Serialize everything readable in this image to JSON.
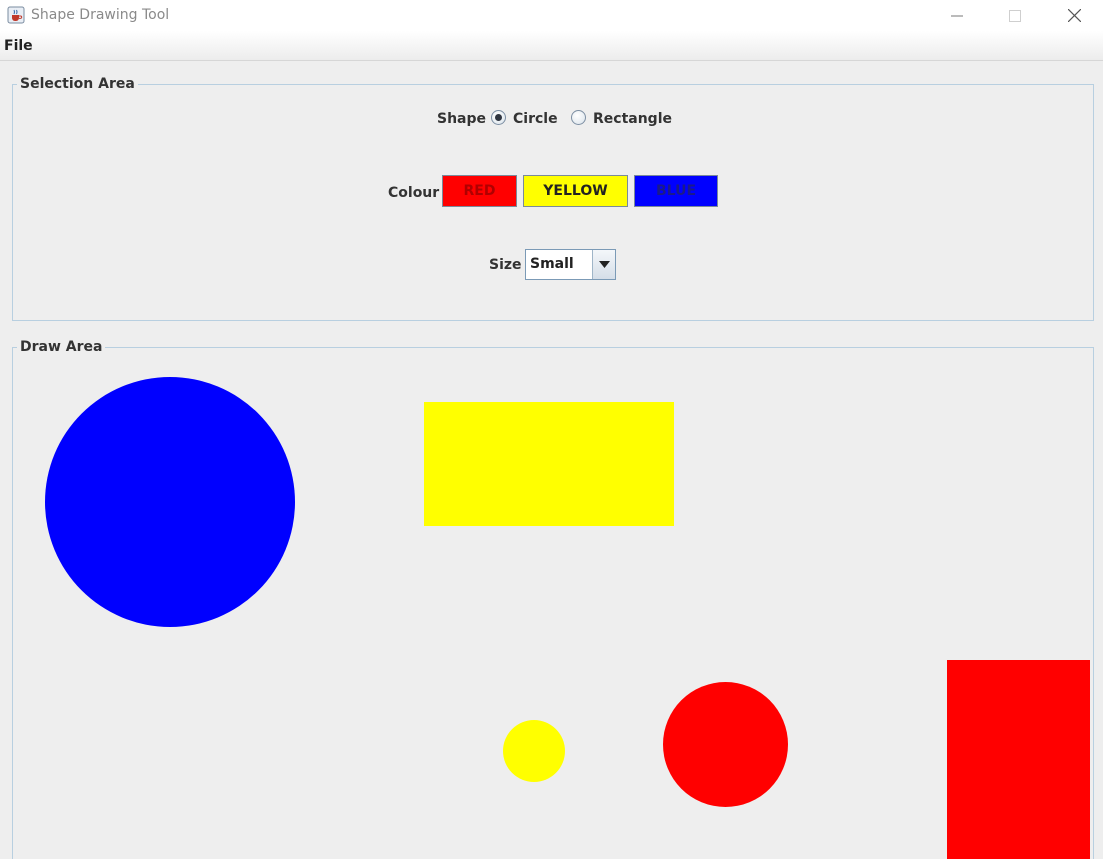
{
  "window": {
    "title": "Shape Drawing Tool",
    "icon": "java-cup-icon",
    "controls": [
      "minimize-icon",
      "maximize-icon",
      "close-icon"
    ]
  },
  "menu": {
    "items": [
      "File"
    ]
  },
  "selection": {
    "title": "Selection Area",
    "shape_label": "Shape",
    "shape_options": [
      "Circle",
      "Rectangle"
    ],
    "shape_selected": "Circle",
    "colour_label": "Colour",
    "colour_buttons": [
      {
        "label": "RED",
        "color": "#ff0000"
      },
      {
        "label": "YELLOW",
        "color": "#ffff00"
      },
      {
        "label": "BLUE",
        "color": "#0000ff"
      }
    ],
    "size_label": "Size",
    "size_value": "Small"
  },
  "draw": {
    "title": "Draw Area",
    "shapes": [
      {
        "type": "circle",
        "color": "#0000ff"
      },
      {
        "type": "rectangle",
        "color": "#ffff00"
      },
      {
        "type": "circle",
        "color": "#ffff00"
      },
      {
        "type": "circle",
        "color": "#ff0000"
      },
      {
        "type": "rectangle",
        "color": "#ff0000"
      }
    ]
  }
}
